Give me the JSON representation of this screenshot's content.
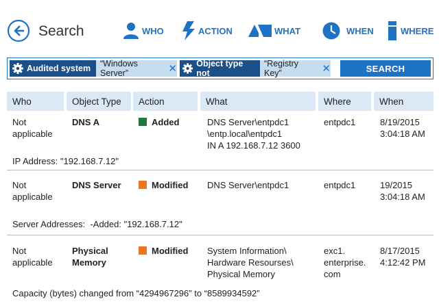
{
  "header": {
    "title": "Search",
    "nav": [
      {
        "label": "WHO",
        "icon": "user-icon"
      },
      {
        "label": "ACTION",
        "icon": "lightning-icon"
      },
      {
        "label": "WHAT",
        "icon": "objects-icon"
      },
      {
        "label": "WHEN",
        "icon": "clock-icon"
      },
      {
        "label": "WHERE",
        "icon": "server-icon"
      }
    ]
  },
  "filters": [
    {
      "name": "Audited system",
      "value": "“Windows Server”",
      "remove": "✕"
    },
    {
      "name": "Object type not",
      "value": "“Registry Key”",
      "remove": "✕"
    }
  ],
  "search_button": "SEARCH",
  "columns": [
    "Who",
    "Object Type",
    "Action",
    "What",
    "Where",
    "When"
  ],
  "rows": [
    {
      "who": "Not\napplicable",
      "object_type": "DNS A",
      "action": "Added",
      "action_color": "#1e7a3c",
      "what": "DNS Server\\entpdc1\n\\entp.local\\entpdc1\nIN A 192.168.7.12 3600",
      "where": "entpdc1",
      "when": "8/19/2015\n3:04:18 AM",
      "detail": "IP Address: \"192.168.7.12\""
    },
    {
      "who": "Not\napplicable",
      "object_type": "DNS Server",
      "action": "Modified",
      "action_color": "#e87722",
      "what": "DNS Server\\entpdc1",
      "where": "entpdc1",
      "when": "19/2015\n3:04:18 AM",
      "detail": "Server Addresses:  -Added: \"192.168.7.12\""
    },
    {
      "who": "Not\napplicable",
      "object_type": "Physical\nMemory",
      "action": "Modified",
      "action_color": "#e87722",
      "what": "System Information\\\nHardware Resourses\\\nPhysical Memory",
      "where": "exc1.\nenterprise.\ncom",
      "when": "8/17/2015\n4:12:42 PM",
      "detail": "Capacity (bytes) changed from “4294967296” to “8589934592”"
    }
  ],
  "colors": {
    "accent": "#1f73c4",
    "chip_dark": "#1b4f87",
    "chip_light": "#c6dcf0",
    "header_bg": "#dbe8f6",
    "added": "#1e7a3c",
    "modified": "#e87722"
  }
}
